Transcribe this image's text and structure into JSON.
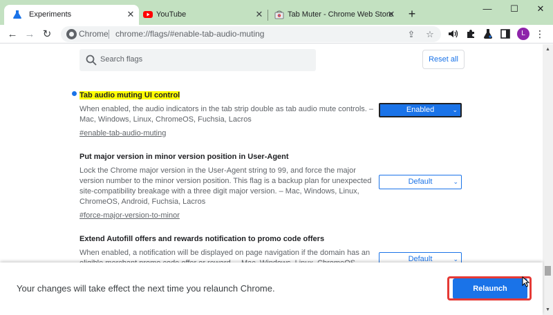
{
  "tabs": [
    {
      "title": "Experiments",
      "icon": "flask-icon",
      "active": true
    },
    {
      "title": "YouTube",
      "icon": "youtube-icon",
      "active": false
    },
    {
      "title": "Tab Muter - Chrome Web Store",
      "icon": "chrome-web-store-icon",
      "active": false
    }
  ],
  "window": {
    "minimize": "—",
    "maximize": "☐",
    "close": "✕"
  },
  "toolbar": {
    "scheme_label": "Chrome",
    "url": "chrome://flags/#enable-tab-audio-muting",
    "avatar_letter": "L"
  },
  "search": {
    "placeholder": "Search flags"
  },
  "reset_label": "Reset all",
  "flags": [
    {
      "title": "Tab audio muting UI control",
      "description": "When enabled, the audio indicators in the tab strip double as tab audio mute controls. – Mac, Windows, Linux, ChromeOS, Fuchsia, Lacros",
      "anchor": "#enable-tab-audio-muting",
      "selected": "Enabled",
      "highlighted": true
    },
    {
      "title": "Put major version in minor version position in User-Agent",
      "description": "Lock the Chrome major version in the User-Agent string to 99, and force the major version number to the minor version position. This flag is a backup plan for unexpected site-compatibility breakage with a three digit major version. – Mac, Windows, Linux, ChromeOS, Android, Fuchsia, Lacros",
      "anchor": "#force-major-version-to-minor",
      "selected": "Default",
      "highlighted": false
    },
    {
      "title": "Extend Autofill offers and rewards notification to promo code offers",
      "description": "When enabled, a notification will be displayed on page navigation if the domain has an eligible merchant promo code offer or reward. – Mac, Windows, Linux, ChromeOS, Android,",
      "selected": "Default",
      "highlighted": false
    }
  ],
  "relaunch": {
    "message": "Your changes will take effect the next time you relaunch Chrome.",
    "button": "Relaunch"
  },
  "colors": {
    "tabstrip": "#c3e1c1",
    "accent": "#1a73e8",
    "highlight": "#ffff00",
    "outline": "#e53935"
  }
}
